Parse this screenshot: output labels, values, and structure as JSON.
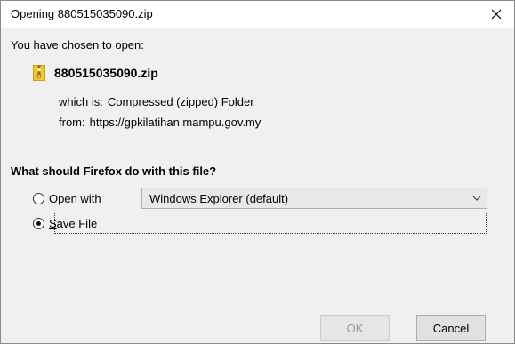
{
  "window": {
    "title": "Opening 880515035090.zip"
  },
  "dialog": {
    "chosen_label": "You have chosen to open:",
    "file_name": "880515035090.zip",
    "which_is_label": "which is:",
    "which_is_value": "Compressed (zipped) Folder",
    "from_label": "from:",
    "from_value": "https://gpkilatihan.mampu.gov.my",
    "question": "What should Firefox do with this file?",
    "open_with": {
      "label_first": "O",
      "label_rest": "pen with",
      "selected_app": "Windows Explorer (default)",
      "checked": false
    },
    "save_file": {
      "label_first": "S",
      "label_rest": "ave File",
      "checked": true
    },
    "buttons": {
      "ok_label": "OK",
      "cancel_label": "Cancel"
    }
  },
  "colors": {
    "zip_icon": "#f2c534",
    "zip_stripe": "#8a6d0b"
  },
  "icons": {
    "close": "close-icon",
    "file": "zip-folder-icon",
    "dropdown": "chevron-down-icon"
  }
}
